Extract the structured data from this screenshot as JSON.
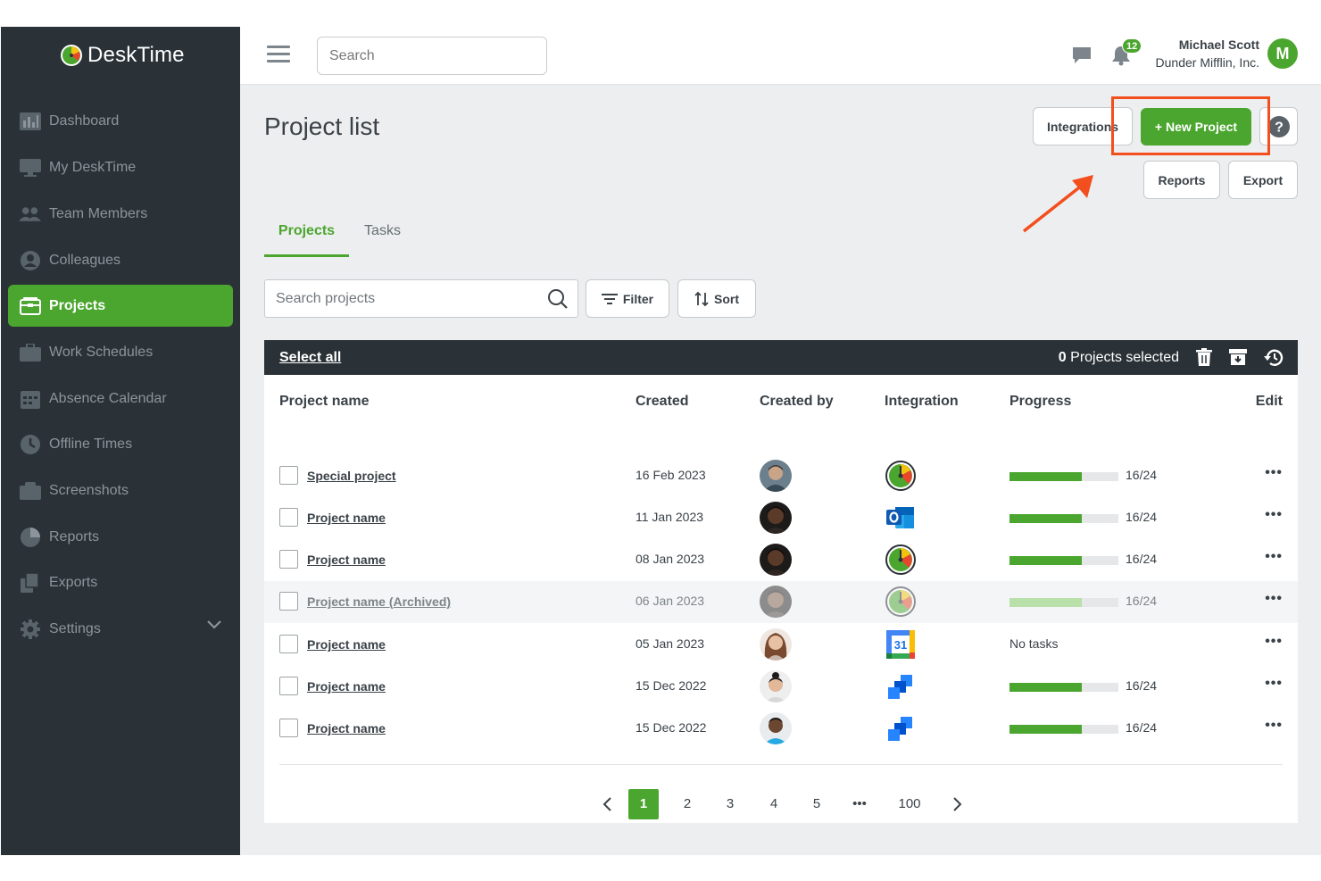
{
  "app": {
    "name": "DeskTime"
  },
  "sidebar": {
    "items": [
      {
        "label": "Dashboard",
        "icon": "bar-chart-icon"
      },
      {
        "label": "My DeskTime",
        "icon": "monitor-icon"
      },
      {
        "label": "Team Members",
        "icon": "team-icon"
      },
      {
        "label": "Colleagues",
        "icon": "person-icon"
      },
      {
        "label": "Projects",
        "icon": "folder-icon",
        "active": true
      },
      {
        "label": "Work Schedules",
        "icon": "briefcase-icon"
      },
      {
        "label": "Absence Calendar",
        "icon": "calendar-icon"
      },
      {
        "label": "Offline Times",
        "icon": "clock-icon"
      },
      {
        "label": "Screenshots",
        "icon": "screenshot-icon"
      },
      {
        "label": "Reports",
        "icon": "pie-chart-icon"
      },
      {
        "label": "Exports",
        "icon": "export-icon"
      },
      {
        "label": "Settings",
        "icon": "gear-icon"
      }
    ]
  },
  "header": {
    "search_placeholder": "Search",
    "notification_count": "12",
    "user_name": "Michael Scott",
    "user_company": "Dunder Mifflin, Inc.",
    "user_initial": "M"
  },
  "page": {
    "title": "Project list",
    "buttons": {
      "integrations": "Integrations",
      "new_project": "+ New Project",
      "help": "?",
      "reports": "Reports",
      "export": "Export"
    },
    "tabs": [
      "Projects",
      "Tasks"
    ],
    "search_placeholder": "Search projects",
    "filter_label": "Filter",
    "sort_label": "Sort"
  },
  "table": {
    "select_all": "Select all",
    "selected_count": "0",
    "selected_suffix": "Projects selected",
    "columns": [
      "Project name",
      "Created",
      "Created by",
      "Integration",
      "Progress",
      "Edit"
    ],
    "rows": [
      {
        "name": "Special project",
        "created": "16 Feb 2023",
        "integration": "desktime-icon",
        "progress": 0.6667,
        "progress_text": "16/24",
        "archived": false
      },
      {
        "name": "Project name",
        "created": "11 Jan 2023",
        "integration": "outlook-icon",
        "progress": 0.6667,
        "progress_text": "16/24",
        "archived": false
      },
      {
        "name": "Project name",
        "created": "08 Jan 2023",
        "integration": "desktime-icon",
        "progress": 0.6667,
        "progress_text": "16/24",
        "archived": false
      },
      {
        "name": "Project name (Archived)",
        "created": "06 Jan 2023",
        "integration": "desktime-icon",
        "progress": 0.6667,
        "progress_text": "16/24",
        "archived": true
      },
      {
        "name": "Project name",
        "created": "05 Jan 2023",
        "integration": "google-calendar-icon",
        "progress": null,
        "progress_text": "No tasks",
        "archived": false
      },
      {
        "name": "Project name",
        "created": "15 Dec 2022",
        "integration": "jira-icon",
        "progress": 0.6667,
        "progress_text": "16/24",
        "archived": false
      },
      {
        "name": "Project name",
        "created": "15 Dec 2022",
        "integration": "jira-icon",
        "progress": 0.6667,
        "progress_text": "16/24",
        "archived": false
      }
    ]
  },
  "pagination": {
    "pages": [
      "1",
      "2",
      "3",
      "4",
      "5",
      "•••",
      "100"
    ],
    "current": "1"
  },
  "colors": {
    "accent": "#4ba62f",
    "sidebar_bg": "#2b3237",
    "highlight": "#f24e1e"
  }
}
